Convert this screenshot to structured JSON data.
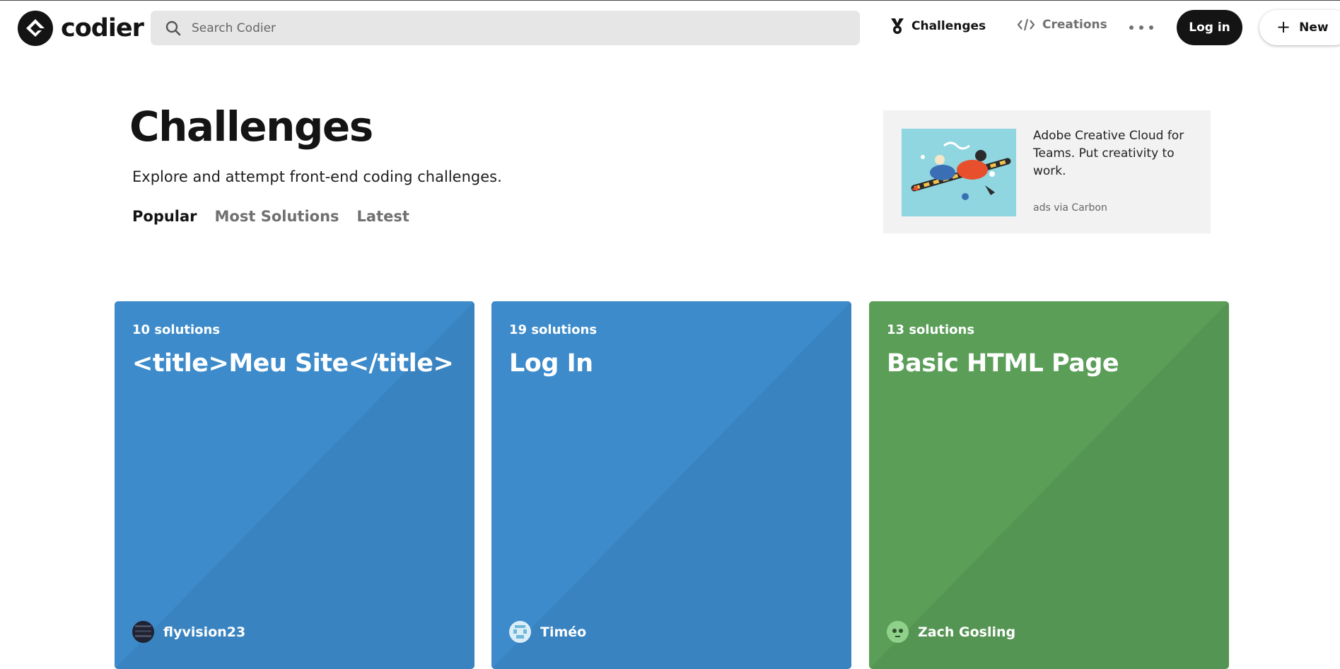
{
  "brand": {
    "name": "codier"
  },
  "search": {
    "placeholder": "Search Codier"
  },
  "nav": {
    "challenges": "Challenges",
    "creations": "Creations"
  },
  "actions": {
    "login": "Log in",
    "new": "New"
  },
  "hero": {
    "title": "Challenges",
    "subtitle": "Explore and attempt front-end coding challenges.",
    "filters": [
      "Popular",
      "Most Solutions",
      "Latest"
    ],
    "active_filter": "Popular"
  },
  "ad": {
    "text": "Adobe Creative Cloud for Teams. Put creativity to work.",
    "credit": "ads via Carbon"
  },
  "cards": [
    {
      "solutions": "10 solutions",
      "title": "<title>Meu Site</title>",
      "author": "flyvision23",
      "color": "#3d8bcb"
    },
    {
      "solutions": "19 solutions",
      "title": "Log In",
      "author": "Timéo",
      "color": "#3d8bcb"
    },
    {
      "solutions": "13 solutions",
      "title": "Basic HTML Page",
      "author": "Zach Gosling",
      "color": "#5a9e58"
    }
  ],
  "colors": {
    "blue_card": "#3d8bcb",
    "green_card": "#5a9e58",
    "dark": "#141414"
  }
}
